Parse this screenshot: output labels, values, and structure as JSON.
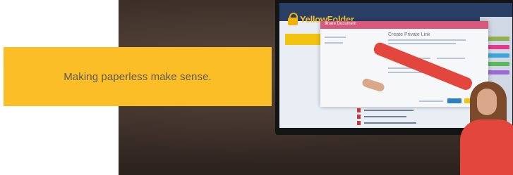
{
  "banner": {
    "tagline": "Making paperless make sense."
  },
  "screen": {
    "logo_text": "YellowFolder",
    "dialog_title": "Share Document",
    "dialog_heading": "Create Private Link",
    "dialog_close": "×"
  },
  "colors": {
    "banner": "#fcbe26",
    "banner_text": "#5d5a55",
    "dialog_header": "#d8587b",
    "app_header": "#2a3f66",
    "logo": "#f6c12d",
    "shirt": "#e2463c"
  }
}
